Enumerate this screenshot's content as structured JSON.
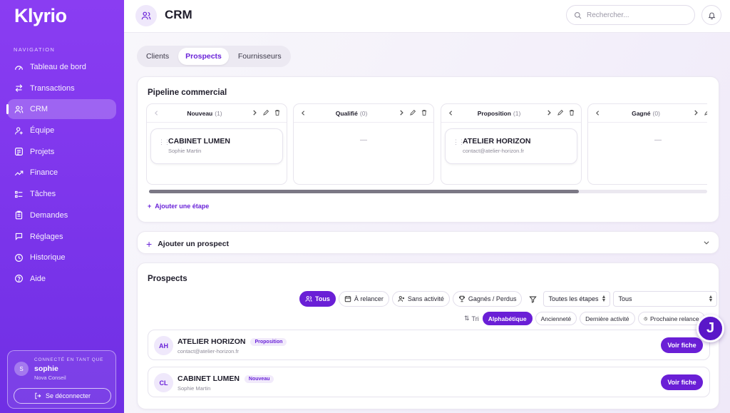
{
  "app": {
    "logo": "Klyrio"
  },
  "sidebar": {
    "section_title": "NAVIGATION",
    "items": [
      {
        "label": "Tableau de bord",
        "icon": "dashboard-icon"
      },
      {
        "label": "Transactions",
        "icon": "transfer-icon"
      },
      {
        "label": "CRM",
        "icon": "users-icon",
        "active": true
      },
      {
        "label": "Équipe",
        "icon": "team-icon"
      },
      {
        "label": "Projets",
        "icon": "folder-icon"
      },
      {
        "label": "Finance",
        "icon": "trend-icon"
      },
      {
        "label": "Tâches",
        "icon": "tasks-icon"
      },
      {
        "label": "Demandes",
        "icon": "clipboard-icon"
      },
      {
        "label": "Réglages",
        "icon": "settings-icon"
      },
      {
        "label": "Historique",
        "icon": "history-icon"
      },
      {
        "label": "Aide",
        "icon": "help-icon"
      }
    ],
    "user": {
      "caption": "CONNECTÉ EN TANT QUE",
      "initial": "S",
      "name": "sophie",
      "company": "Nova Conseil",
      "logout_label": "Se déconnecter"
    }
  },
  "header": {
    "title": "CRM",
    "search_placeholder": "Rechercher..."
  },
  "tabs": [
    {
      "label": "Clients"
    },
    {
      "label": "Prospects",
      "active": true
    },
    {
      "label": "Fournisseurs"
    }
  ],
  "pipeline": {
    "title": "Pipeline commercial",
    "columns": [
      {
        "name": "Nouveau",
        "count": "(1)",
        "cards": [
          {
            "name": "CABINET LUMEN",
            "sub": "Sophie Martin"
          }
        ]
      },
      {
        "name": "Qualifié",
        "count": "(0)",
        "empty": "—"
      },
      {
        "name": "Proposition",
        "count": "(1)",
        "cards": [
          {
            "name": "ATELIER HORIZON",
            "sub": "contact@atelier-horizon.fr"
          }
        ]
      },
      {
        "name": "Gagné",
        "count": "(0)",
        "empty": "—"
      }
    ],
    "scroll_fraction": 0.77,
    "add_stage_label": "Ajouter une étape"
  },
  "add_prospect": {
    "label": "Ajouter un prospect"
  },
  "prospects": {
    "title": "Prospects",
    "filters": [
      {
        "label": "Tous",
        "icon": "users-icon",
        "active": true
      },
      {
        "label": "À relancer",
        "icon": "calendar-icon"
      },
      {
        "label": "Sans activité",
        "icon": "user-x-icon"
      },
      {
        "label": "Gagnés / Perdus",
        "icon": "trophy-icon"
      }
    ],
    "stage_select": "Toutes les étapes",
    "status_select": "Tous",
    "sort_label": "Tri",
    "sorts": [
      {
        "label": "Alphabétique",
        "active": true
      },
      {
        "label": "Ancienneté"
      },
      {
        "label": "Dernière activité"
      },
      {
        "label": "Prochaine relance",
        "icon": "clock-icon"
      }
    ],
    "rows": [
      {
        "initials": "AH",
        "name": "ATELIER HORIZON",
        "stage": "Proposition",
        "sub": "contact@atelier-horizon.fr",
        "action": "Voir fiche"
      },
      {
        "initials": "CL",
        "name": "CABINET LUMEN",
        "stage": "Nouveau",
        "sub": "Sophie Martin",
        "action": "Voir fiche"
      }
    ]
  },
  "floating_button": {
    "label": "J"
  },
  "colors": {
    "primary": "#6a1fd6",
    "sidebar": "#8a3df2",
    "accent_text": "#6a23d8"
  }
}
